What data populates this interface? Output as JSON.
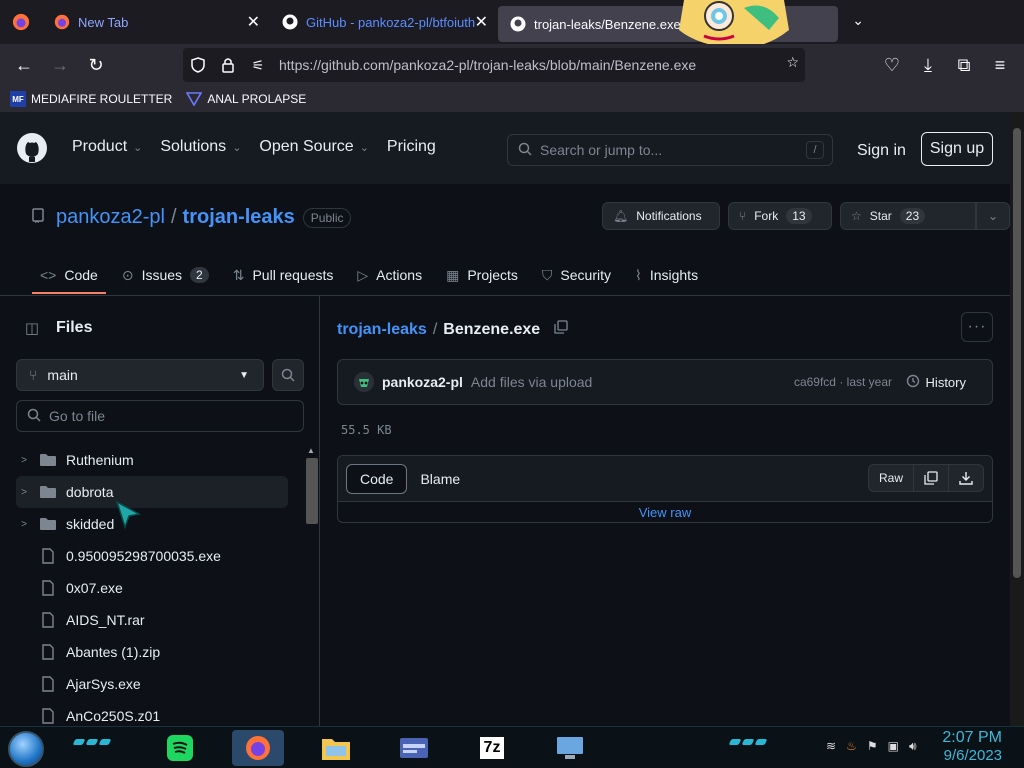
{
  "browser": {
    "tabs": [
      {
        "title": "New Tab"
      },
      {
        "title": "GitHub - pankoza2-pl/btfoiuth"
      },
      {
        "title": "trojan-leaks/Benzene.exe at"
      }
    ],
    "url": "https://github.com/pankoza2-pl/trojan-leaks/blob/main/Benzene.exe",
    "bookmarks": [
      {
        "label": "MEDIAFIRE ROULETTER",
        "icon_text": "MF"
      },
      {
        "label": "ANAL PROLAPSE"
      }
    ]
  },
  "github": {
    "nav": [
      "Product",
      "Solutions",
      "Open Source",
      "Pricing"
    ],
    "search_placeholder": "Search or jump to...",
    "search_shortcut": "/",
    "sign_in": "Sign in",
    "sign_up": "Sign up"
  },
  "repo": {
    "owner": "pankoza2-pl",
    "separator": "/",
    "name": "trojan-leaks",
    "visibility": "Public",
    "notifications_label": "Notifications",
    "fork_label": "Fork",
    "fork_count": "13",
    "star_label": "Star",
    "star_count": "23",
    "tabs": [
      {
        "label": "Code",
        "icon": "code-icon"
      },
      {
        "label": "Issues",
        "icon": "issue-icon",
        "count": "2"
      },
      {
        "label": "Pull requests",
        "icon": "pull-request-icon"
      },
      {
        "label": "Actions",
        "icon": "play-icon"
      },
      {
        "label": "Projects",
        "icon": "table-icon"
      },
      {
        "label": "Security",
        "icon": "shield-icon"
      },
      {
        "label": "Insights",
        "icon": "graph-icon"
      }
    ]
  },
  "sidebar": {
    "title": "Files",
    "branch": "main",
    "goto_placeholder": "Go to file",
    "items": [
      {
        "name": "Ruthenium",
        "type": "folder"
      },
      {
        "name": "dobrota",
        "type": "folder"
      },
      {
        "name": "skidded",
        "type": "folder"
      },
      {
        "name": "0.950095298700035.exe",
        "type": "file"
      },
      {
        "name": "0x07.exe",
        "type": "file"
      },
      {
        "name": "AIDS_NT.rar",
        "type": "file"
      },
      {
        "name": "Abantes (1).zip",
        "type": "file"
      },
      {
        "name": "AjarSys.exe",
        "type": "file"
      },
      {
        "name": "AnCo250S.z01",
        "type": "file"
      }
    ]
  },
  "file": {
    "repo_crumb": "trojan-leaks",
    "crumb_sep": "/",
    "name": "Benzene.exe",
    "commit_author": "pankoza2-pl",
    "commit_message": "Add files via upload",
    "commit_hash_time": "ca69fcd · last year",
    "history_label": "History",
    "size": "55.5 KB",
    "tab_code": "Code",
    "tab_blame": "Blame",
    "raw_label": "Raw",
    "view_raw": "View raw"
  },
  "taskbar": {
    "time": "2:07 PM",
    "date": "9/6/2023",
    "sevenzip_label": "7z"
  },
  "colors": {
    "accent_link": "#4493f8",
    "tab_underline": "#f78166",
    "clock": "#3fb8d8"
  }
}
